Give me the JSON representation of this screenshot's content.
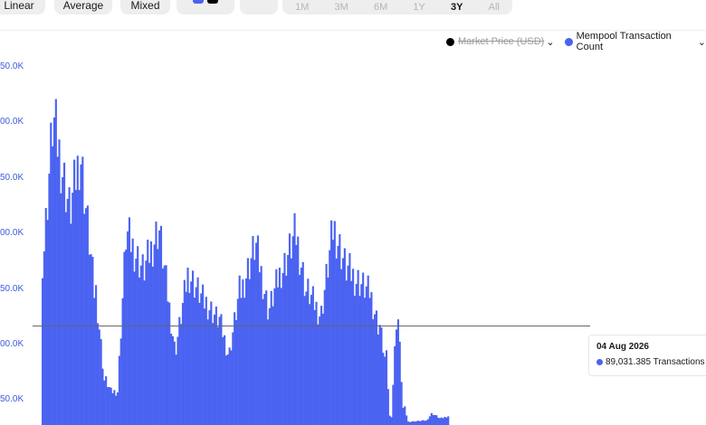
{
  "toolbar": {
    "scale_buttons": [
      "Linear",
      "Average",
      "Mixed"
    ],
    "color_swatches": [
      "#4b63f1",
      "#000000"
    ],
    "camera_icon": "camera-icon",
    "time_ranges": [
      "1M",
      "3M",
      "6M",
      "1Y",
      "3Y",
      "All"
    ],
    "active_range": "3Y"
  },
  "legend": [
    {
      "label": "Market Price (USD)",
      "color": "#000000",
      "hidden": true
    },
    {
      "label": "Mempool Transaction Count",
      "color": "#4b63f1",
      "hidden": false
    }
  ],
  "tooltip": {
    "date": "04 Aug 2026",
    "value_text": "89,031.385 Transactions",
    "color": "#4b63f1"
  },
  "chart_data": {
    "type": "bar",
    "title": "",
    "xlabel": "",
    "ylabel": "",
    "ytick_labels": [
      "50.0K",
      "00.0K",
      "50.0K",
      "00.0K",
      "50.0K",
      "00.0K",
      "50.0K"
    ],
    "ylim": [
      0,
      350000
    ],
    "grid": false,
    "legend_position": "top-right",
    "color": "#4b63f1",
    "cursor_value": 89031.385,
    "segments": [
      {
        "start": 150000,
        "end": 160000,
        "bars": 1
      },
      {
        "start": 160000,
        "end": 270000,
        "bars": 6
      },
      {
        "start": 270000,
        "end": 195000,
        "bars": 10
      },
      {
        "start": 195000,
        "end": 240000,
        "bars": 6
      },
      {
        "start": 240000,
        "end": 120000,
        "bars": 9
      },
      {
        "start": 120000,
        "end": 40000,
        "bars": 6
      },
      {
        "start": 40000,
        "end": 30000,
        "bars": 4
      },
      {
        "start": 30000,
        "end": 30000,
        "bars": 3
      },
      {
        "start": 30000,
        "end": 170000,
        "bars": 6
      },
      {
        "start": 170000,
        "end": 140000,
        "bars": 10
      },
      {
        "start": 140000,
        "end": 175000,
        "bars": 9
      },
      {
        "start": 175000,
        "end": 70000,
        "bars": 10
      },
      {
        "start": 70000,
        "end": 135000,
        "bars": 8
      },
      {
        "start": 135000,
        "end": 110000,
        "bars": 10
      },
      {
        "start": 110000,
        "end": 95000,
        "bars": 8
      },
      {
        "start": 95000,
        "end": 65000,
        "bars": 6
      },
      {
        "start": 65000,
        "end": 120000,
        "bars": 7
      },
      {
        "start": 120000,
        "end": 160000,
        "bars": 9
      },
      {
        "start": 160000,
        "end": 105000,
        "bars": 8
      },
      {
        "start": 105000,
        "end": 140000,
        "bars": 8
      },
      {
        "start": 140000,
        "end": 170000,
        "bars": 8
      },
      {
        "start": 170000,
        "end": 120000,
        "bars": 7
      },
      {
        "start": 120000,
        "end": 100000,
        "bars": 8
      },
      {
        "start": 100000,
        "end": 175000,
        "bars": 8
      },
      {
        "start": 175000,
        "end": 140000,
        "bars": 8
      },
      {
        "start": 140000,
        "end": 130000,
        "bars": 6
      },
      {
        "start": 130000,
        "end": 120000,
        "bars": 7
      },
      {
        "start": 120000,
        "end": 90000,
        "bars": 6
      },
      {
        "start": 90000,
        "end": 60000,
        "bars": 4
      },
      {
        "start": 60000,
        "end": 8000,
        "bars": 3
      },
      {
        "start": 8000,
        "end": 95000,
        "bars": 4
      },
      {
        "start": 95000,
        "end": 15000,
        "bars": 4
      },
      {
        "start": 15000,
        "end": 3000,
        "bars": 3
      },
      {
        "start": 3000,
        "end": 4000,
        "bars": 10
      },
      {
        "start": 4000,
        "end": 10000,
        "bars": 4
      },
      {
        "start": 10000,
        "end": 6000,
        "bars": 5
      },
      {
        "start": 6000,
        "end": 8000,
        "bars": 5
      }
    ]
  }
}
